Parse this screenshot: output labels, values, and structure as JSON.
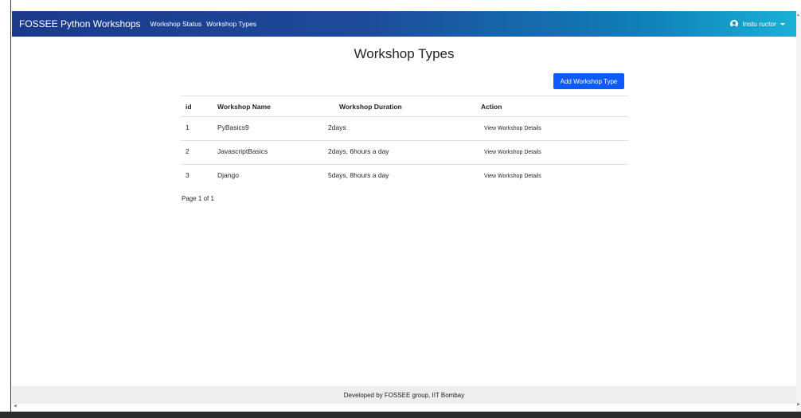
{
  "navbar": {
    "brand": "FOSSEE Python Workshops",
    "links": [
      "Workshop Status",
      "Workshop Types"
    ],
    "user": "Instu ructor",
    "gradient_colors": [
      "#1b3a8a",
      "#1ab0d6"
    ]
  },
  "page": {
    "title": "Workshop Types",
    "add_button": "Add Workshop Type",
    "button_color": "#0d5bff"
  },
  "table": {
    "headers": [
      "id",
      "Workshop Name",
      "Workshop Duration",
      "Action"
    ],
    "rows": [
      {
        "id": "1",
        "name": "PyBasics9",
        "duration": "2days",
        "action": "View Workshop Details"
      },
      {
        "id": "2",
        "name": "JavascriptBasics",
        "duration": "2days, 6hours a day",
        "action": "View Workshop Details"
      },
      {
        "id": "3",
        "name": "Django",
        "duration": "5days, 8hours a day",
        "action": "View Workshop Details"
      }
    ]
  },
  "pagination": {
    "text": "Page 1 of 1"
  },
  "footer": {
    "text": "Developed by FOSSEE group, IIT Bombay"
  },
  "icons": {
    "user": "user-circle-icon",
    "caret": "caret-down-icon"
  }
}
